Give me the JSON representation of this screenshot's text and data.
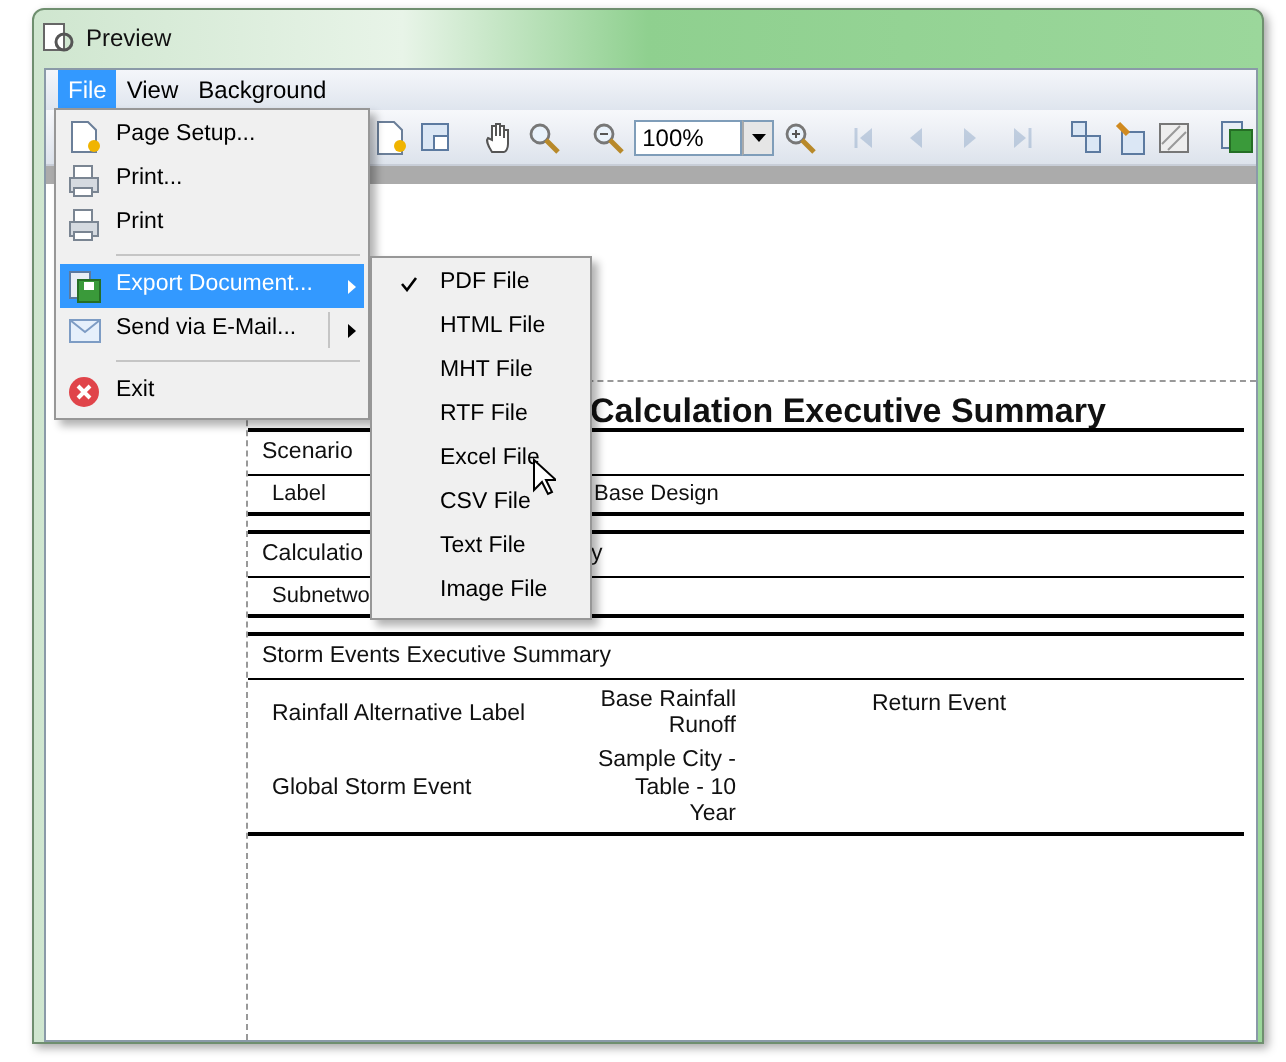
{
  "window": {
    "title": "Preview"
  },
  "menu_bar": [
    {
      "label": "File",
      "selected": true
    },
    {
      "label": "View",
      "selected": false
    },
    {
      "label": "Background",
      "selected": false
    }
  ],
  "toolbar": {
    "zoom_value": "100%",
    "navigation_disabled": true
  },
  "file_menu": [
    {
      "kind": "item",
      "label": "Page Setup...",
      "selected": false
    },
    {
      "kind": "item",
      "label": "Print...",
      "selected": false
    },
    {
      "kind": "item",
      "label": "Print",
      "selected": false
    },
    {
      "kind": "separator"
    },
    {
      "kind": "submenu",
      "label": "Export Document...",
      "selected": true
    },
    {
      "kind": "split-submenu",
      "label": "Send via E-Mail...",
      "selected": false
    },
    {
      "kind": "separator"
    },
    {
      "kind": "item",
      "label": "Exit",
      "selected": false
    }
  ],
  "export_submenu": [
    {
      "label": "PDF File",
      "checked": true
    },
    {
      "label": "HTML File",
      "checked": false
    },
    {
      "label": "MHT File",
      "checked": false
    },
    {
      "label": "RTF File",
      "checked": false
    },
    {
      "label": "Excel File",
      "checked": false
    },
    {
      "label": "CSV File",
      "checked": false
    },
    {
      "label": "Text File",
      "checked": false
    },
    {
      "label": "Image File",
      "checked": false
    }
  ],
  "report": {
    "title": "Calculation Executive Summary",
    "sections": [
      {
        "kind": "pairs",
        "header": "Scenario",
        "rows": [
          [
            "Label",
            "Base Design"
          ]
        ]
      },
      {
        "kind": "pairs",
        "header": "Calculatio",
        "header_tail": "y",
        "rows": [
          [
            "Subnetwo"
          ]
        ]
      },
      {
        "kind": "table",
        "header": "Storm Events Executive Summary",
        "rows": [
          [
            "Rainfall Alternative Label",
            "Base Rainfall Runoff",
            "Return Event"
          ],
          [
            "Global Storm Event",
            "Sample City - Table - 10 Year"
          ]
        ]
      }
    ]
  }
}
